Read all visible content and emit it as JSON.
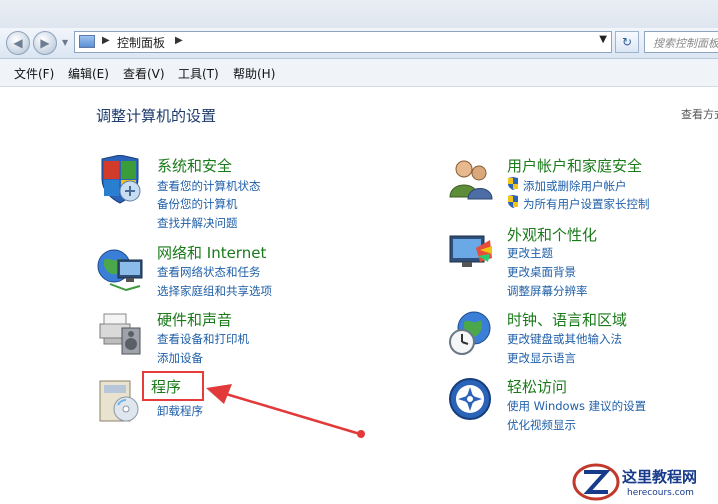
{
  "nav": {
    "back_icon": "back-arrow-icon",
    "forward_icon": "forward-arrow-icon",
    "address": "控制面板",
    "search_placeholder": "搜索控制面板"
  },
  "menu": [
    "文件(F)",
    "编辑(E)",
    "查看(V)",
    "工具(T)",
    "帮助(H)"
  ],
  "page": {
    "title": "调整计算机的设置",
    "view_label": "查看方式"
  },
  "left_categories": [
    {
      "title": "系统和安全",
      "icon": "system-security-icon",
      "links": [
        "查看您的计算机状态",
        "备份您的计算机",
        "查找并解决问题"
      ]
    },
    {
      "title": "网络和 Internet",
      "icon": "network-internet-icon",
      "links": [
        "查看网络状态和任务",
        "选择家庭组和共享选项"
      ]
    },
    {
      "title": "硬件和声音",
      "icon": "hardware-sound-icon",
      "links": [
        "查看设备和打印机",
        "添加设备"
      ]
    },
    {
      "title": "程序",
      "icon": "programs-icon",
      "links": [
        "卸载程序"
      ]
    }
  ],
  "right_categories": [
    {
      "title": "用户帐户和家庭安全",
      "icon": "user-accounts-icon",
      "links": [
        "添加或删除用户帐户",
        "为所有用户设置家长控制"
      ]
    },
    {
      "title": "外观和个性化",
      "icon": "appearance-icon",
      "links": [
        "更改主题",
        "更改桌面背景",
        "调整屏幕分辨率"
      ]
    },
    {
      "title": "时钟、语言和区域",
      "icon": "clock-language-region-icon",
      "links": [
        "更改键盘或其他输入法",
        "更改显示语言"
      ]
    },
    {
      "title": "轻松访问",
      "icon": "ease-of-access-icon",
      "links": [
        "使用 Windows 建议的设置",
        "优化视频显示"
      ]
    }
  ],
  "watermark": {
    "name": "这里教程网",
    "url": "herecours.com"
  },
  "colors": {
    "category_title": "#1a7a1a",
    "link": "#1f5fa8",
    "page_title": "#1e3b6c",
    "highlight": "#e63b3b"
  }
}
